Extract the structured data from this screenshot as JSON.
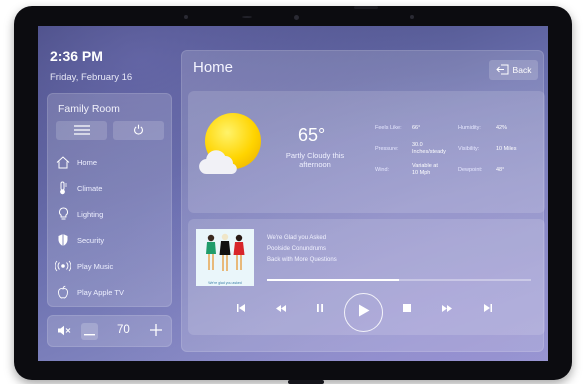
{
  "clock": {
    "time": "2:36 PM",
    "date": "Friday, February 16"
  },
  "sidebar": {
    "room": "Family Room",
    "buttons": [
      {
        "icon": "menu-icon"
      },
      {
        "icon": "power-icon"
      }
    ],
    "items": [
      {
        "label": "Home",
        "icon": "home-icon"
      },
      {
        "label": "Climate",
        "icon": "thermometer-icon"
      },
      {
        "label": "Lighting",
        "icon": "lightbulb-icon"
      },
      {
        "label": "Security",
        "icon": "shield-icon"
      },
      {
        "label": "Play Music",
        "icon": "speaker-icon"
      },
      {
        "label": "Play Apple TV",
        "icon": "apple-icon"
      }
    ]
  },
  "volume": {
    "mute_icon": "mute-icon",
    "minus_icon": "minus-icon",
    "plus_icon": "plus-icon",
    "value": "70"
  },
  "main": {
    "title": "Home",
    "back_label": "Back",
    "back_icon": "back-arrow-icon"
  },
  "weather": {
    "icon": "partly-cloudy-icon",
    "temperature": "65°",
    "condition": "Partly Cloudy this afternoon",
    "details": {
      "feels_like_label": "Feels Like:",
      "feels_like_value": "66°",
      "humidity_label": "Humidity:",
      "humidity_value": "42%",
      "pressure_label": "Pressure:",
      "pressure_value_1": "30.0",
      "pressure_value_2": "Inches/steady",
      "visibility_label": "Visibility:",
      "visibility_value": "10 Miles",
      "wind_label": "Wind:",
      "wind_value_1": "Variable at",
      "wind_value_2": "10 Mph",
      "dewpoint_label": "Dewpoint:",
      "dewpoint_value": "48°"
    }
  },
  "player": {
    "album_caption": "We're glad you asked",
    "track_title": "We're Glad you Asked",
    "track_artist": "Poolside Conundrums",
    "track_album": "Back with More Questions",
    "progress": 0.5,
    "controls": [
      "skip-back-icon",
      "rewind-icon",
      "pause-icon",
      "play-icon",
      "stop-icon",
      "fast-forward-icon",
      "skip-forward-icon"
    ]
  },
  "colors": {
    "accent_sun": "#ffd400",
    "screen_top": "#3b3f73",
    "screen_bottom": "#9a9cd2",
    "art_red": "#d8262b"
  }
}
